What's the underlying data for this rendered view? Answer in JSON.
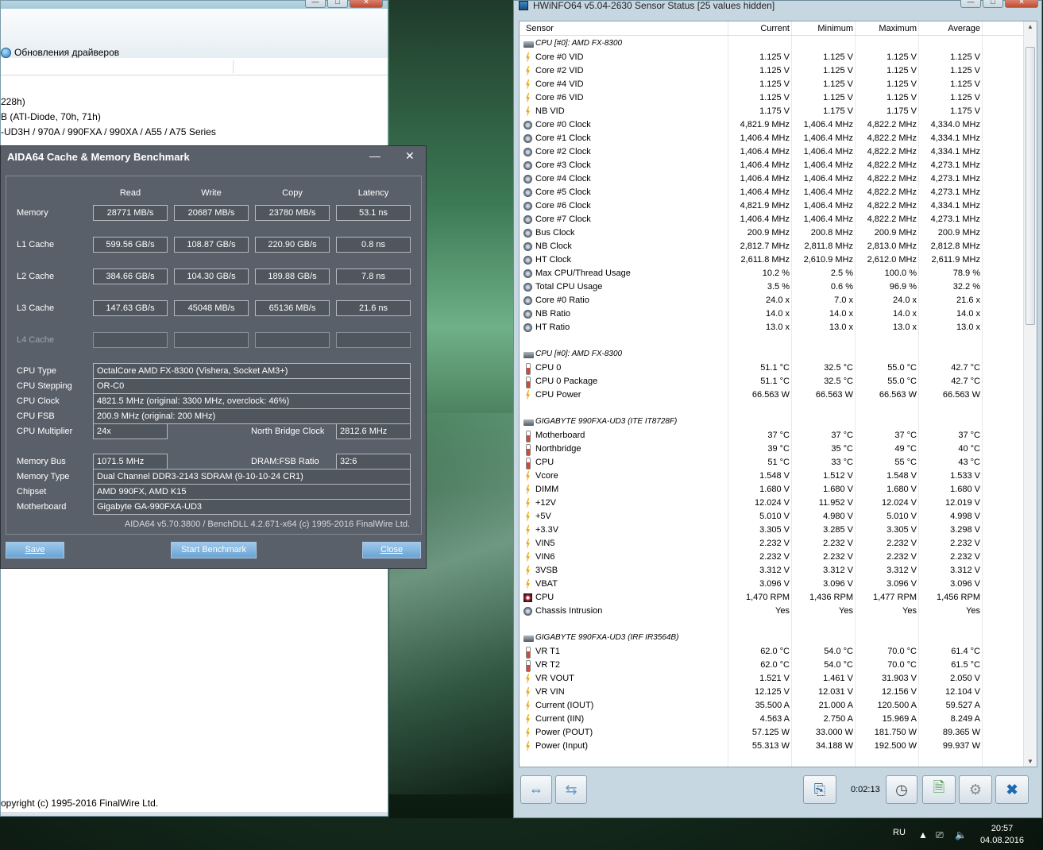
{
  "main_window": {
    "toolbar_item": "Обновления драйверов",
    "info_lines": [
      "228h)",
      "B  (ATI-Diode, 70h, 71h)",
      "-UD3H / 970A / 990FXA / 990XA / A55 / A75 Series"
    ],
    "footer": "opyright (c) 1995-2016 FinalWire Ltd."
  },
  "benchmark": {
    "title": "AIDA64 Cache & Memory Benchmark",
    "minimize": "—",
    "close": "✕",
    "columns": [
      "Read",
      "Write",
      "Copy",
      "Latency"
    ],
    "rows": [
      {
        "label": "Memory",
        "values": [
          "28771 MB/s",
          "20687 MB/s",
          "23780 MB/s",
          "53.1 ns"
        ]
      },
      {
        "label": "L1 Cache",
        "values": [
          "599.56 GB/s",
          "108.87 GB/s",
          "220.90 GB/s",
          "0.8 ns"
        ]
      },
      {
        "label": "L2 Cache",
        "values": [
          "384.66 GB/s",
          "104.30 GB/s",
          "189.88 GB/s",
          "7.8 ns"
        ]
      },
      {
        "label": "L3 Cache",
        "values": [
          "147.63 GB/s",
          "45048 MB/s",
          "65136 MB/s",
          "21.6 ns"
        ]
      },
      {
        "label": "L4 Cache",
        "values": [
          "",
          "",
          "",
          ""
        ]
      }
    ],
    "cpu_type_label": "CPU Type",
    "cpu_type": "OctalCore AMD FX-8300  (Vishera, Socket AM3+)",
    "cpu_stepping_label": "CPU Stepping",
    "cpu_stepping": "OR-C0",
    "cpu_clock_label": "CPU Clock",
    "cpu_clock": "4821.5 MHz  (original: 3300 MHz, overclock: 46%)",
    "cpu_fsb_label": "CPU FSB",
    "cpu_fsb": "200.9 MHz  (original: 200 MHz)",
    "cpu_mult_label": "CPU Multiplier",
    "cpu_mult": "24x",
    "nb_clock_label": "North Bridge Clock",
    "nb_clock": "2812.6 MHz",
    "mem_bus_label": "Memory Bus",
    "mem_bus": "1071.5 MHz",
    "dram_ratio_label": "DRAM:FSB Ratio",
    "dram_ratio": "32:6",
    "mem_type_label": "Memory Type",
    "mem_type": "Dual Channel DDR3-2143 SDRAM  (9-10-10-24 CR1)",
    "chipset_label": "Chipset",
    "chipset": "AMD 990FX, AMD K15",
    "mobo_label": "Motherboard",
    "mobo": "Gigabyte GA-990FXA-UD3",
    "version": "AIDA64 v5.70.3800 / BenchDLL 4.2.671-x64  (c) 1995-2016 FinalWire Ltd.",
    "save": "Save",
    "start": "Start Benchmark",
    "close_btn": "Close"
  },
  "hwinfo": {
    "title": "HWiNFO64 v5.04-2630 Sensor Status [25 values hidden]",
    "columns": [
      "Sensor",
      "Current",
      "Minimum",
      "Maximum",
      "Average"
    ],
    "timer": "0:02:13",
    "rows": [
      {
        "t": "grp",
        "n": "CPU [#0]: AMD FX-8300"
      },
      {
        "t": "volt",
        "n": "Core #0 VID",
        "v": [
          "1.125 V",
          "1.125 V",
          "1.125 V",
          "1.125 V"
        ]
      },
      {
        "t": "volt",
        "n": "Core #2 VID",
        "v": [
          "1.125 V",
          "1.125 V",
          "1.125 V",
          "1.125 V"
        ]
      },
      {
        "t": "volt",
        "n": "Core #4 VID",
        "v": [
          "1.125 V",
          "1.125 V",
          "1.125 V",
          "1.125 V"
        ]
      },
      {
        "t": "volt",
        "n": "Core #6 VID",
        "v": [
          "1.125 V",
          "1.125 V",
          "1.125 V",
          "1.125 V"
        ]
      },
      {
        "t": "volt",
        "n": "NB VID",
        "v": [
          "1.175 V",
          "1.175 V",
          "1.175 V",
          "1.175 V"
        ]
      },
      {
        "t": "clock",
        "n": "Core #0 Clock",
        "v": [
          "4,821.9 MHz",
          "1,406.4 MHz",
          "4,822.2 MHz",
          "4,334.0 MHz"
        ]
      },
      {
        "t": "clock",
        "n": "Core #1 Clock",
        "v": [
          "1,406.4 MHz",
          "1,406.4 MHz",
          "4,822.2 MHz",
          "4,334.1 MHz"
        ]
      },
      {
        "t": "clock",
        "n": "Core #2 Clock",
        "v": [
          "1,406.4 MHz",
          "1,406.4 MHz",
          "4,822.2 MHz",
          "4,334.1 MHz"
        ]
      },
      {
        "t": "clock",
        "n": "Core #3 Clock",
        "v": [
          "1,406.4 MHz",
          "1,406.4 MHz",
          "4,822.2 MHz",
          "4,273.1 MHz"
        ]
      },
      {
        "t": "clock",
        "n": "Core #4 Clock",
        "v": [
          "1,406.4 MHz",
          "1,406.4 MHz",
          "4,822.2 MHz",
          "4,273.1 MHz"
        ]
      },
      {
        "t": "clock",
        "n": "Core #5 Clock",
        "v": [
          "1,406.4 MHz",
          "1,406.4 MHz",
          "4,822.2 MHz",
          "4,273.1 MHz"
        ]
      },
      {
        "t": "clock",
        "n": "Core #6 Clock",
        "v": [
          "4,821.9 MHz",
          "1,406.4 MHz",
          "4,822.2 MHz",
          "4,334.1 MHz"
        ]
      },
      {
        "t": "clock",
        "n": "Core #7 Clock",
        "v": [
          "1,406.4 MHz",
          "1,406.4 MHz",
          "4,822.2 MHz",
          "4,273.1 MHz"
        ]
      },
      {
        "t": "clock",
        "n": "Bus Clock",
        "v": [
          "200.9 MHz",
          "200.8 MHz",
          "200.9 MHz",
          "200.9 MHz"
        ]
      },
      {
        "t": "clock",
        "n": "NB Clock",
        "v": [
          "2,812.7 MHz",
          "2,811.8 MHz",
          "2,813.0 MHz",
          "2,812.8 MHz"
        ]
      },
      {
        "t": "clock",
        "n": "HT Clock",
        "v": [
          "2,611.8 MHz",
          "2,610.9 MHz",
          "2,612.0 MHz",
          "2,611.9 MHz"
        ]
      },
      {
        "t": "clock",
        "n": "Max CPU/Thread Usage",
        "v": [
          "10.2 %",
          "2.5 %",
          "100.0 %",
          "78.9 %"
        ]
      },
      {
        "t": "clock",
        "n": "Total CPU Usage",
        "v": [
          "3.5 %",
          "0.6 %",
          "96.9 %",
          "32.2 %"
        ]
      },
      {
        "t": "clock",
        "n": "Core #0 Ratio",
        "v": [
          "24.0 x",
          "7.0 x",
          "24.0 x",
          "21.6 x"
        ]
      },
      {
        "t": "clock",
        "n": "NB Ratio",
        "v": [
          "14.0 x",
          "14.0 x",
          "14.0 x",
          "14.0 x"
        ]
      },
      {
        "t": "clock",
        "n": "HT Ratio",
        "v": [
          "13.0 x",
          "13.0 x",
          "13.0 x",
          "13.0 x"
        ]
      },
      {
        "t": "blank",
        "n": ""
      },
      {
        "t": "grp",
        "n": "CPU [#0]: AMD FX-8300"
      },
      {
        "t": "temp",
        "n": "CPU 0",
        "v": [
          "51.1 °C",
          "32.5 °C",
          "55.0 °C",
          "42.7 °C"
        ]
      },
      {
        "t": "temp",
        "n": "CPU 0 Package",
        "v": [
          "51.1 °C",
          "32.5 °C",
          "55.0 °C",
          "42.7 °C"
        ]
      },
      {
        "t": "volt",
        "n": "CPU Power",
        "v": [
          "66.563 W",
          "66.563 W",
          "66.563 W",
          "66.563 W"
        ]
      },
      {
        "t": "blank",
        "n": ""
      },
      {
        "t": "grp",
        "n": "GIGABYTE 990FXA-UD3 (ITE IT8728F)"
      },
      {
        "t": "temp",
        "n": "Motherboard",
        "v": [
          "37 °C",
          "37 °C",
          "37 °C",
          "37 °C"
        ]
      },
      {
        "t": "temp",
        "n": "Northbridge",
        "v": [
          "39 °C",
          "35 °C",
          "49 °C",
          "40 °C"
        ]
      },
      {
        "t": "temp",
        "n": "CPU",
        "v": [
          "51 °C",
          "33 °C",
          "55 °C",
          "43 °C"
        ]
      },
      {
        "t": "volt",
        "n": "Vcore",
        "v": [
          "1.548 V",
          "1.512 V",
          "1.548 V",
          "1.533 V"
        ]
      },
      {
        "t": "volt",
        "n": "DIMM",
        "v": [
          "1.680 V",
          "1.680 V",
          "1.680 V",
          "1.680 V"
        ]
      },
      {
        "t": "volt",
        "n": "+12V",
        "v": [
          "12.024 V",
          "11.952 V",
          "12.024 V",
          "12.019 V"
        ]
      },
      {
        "t": "volt",
        "n": "+5V",
        "v": [
          "5.010 V",
          "4.980 V",
          "5.010 V",
          "4.998 V"
        ]
      },
      {
        "t": "volt",
        "n": "+3.3V",
        "v": [
          "3.305 V",
          "3.285 V",
          "3.305 V",
          "3.298 V"
        ]
      },
      {
        "t": "volt",
        "n": "VIN5",
        "v": [
          "2.232 V",
          "2.232 V",
          "2.232 V",
          "2.232 V"
        ]
      },
      {
        "t": "volt",
        "n": "VIN6",
        "v": [
          "2.232 V",
          "2.232 V",
          "2.232 V",
          "2.232 V"
        ]
      },
      {
        "t": "volt",
        "n": "3VSB",
        "v": [
          "3.312 V",
          "3.312 V",
          "3.312 V",
          "3.312 V"
        ]
      },
      {
        "t": "volt",
        "n": "VBAT",
        "v": [
          "3.096 V",
          "3.096 V",
          "3.096 V",
          "3.096 V"
        ]
      },
      {
        "t": "fan",
        "n": "CPU",
        "v": [
          "1,470 RPM",
          "1,436 RPM",
          "1,477 RPM",
          "1,456 RPM"
        ]
      },
      {
        "t": "clock",
        "n": "Chassis Intrusion",
        "v": [
          "Yes",
          "Yes",
          "Yes",
          "Yes"
        ]
      },
      {
        "t": "blank",
        "n": ""
      },
      {
        "t": "grp",
        "n": "GIGABYTE 990FXA-UD3 (IRF IR3564B)"
      },
      {
        "t": "temp",
        "n": "VR T1",
        "v": [
          "62.0 °C",
          "54.0 °C",
          "70.0 °C",
          "61.4 °C"
        ]
      },
      {
        "t": "temp",
        "n": "VR T2",
        "v": [
          "62.0 °C",
          "54.0 °C",
          "70.0 °C",
          "61.5 °C"
        ]
      },
      {
        "t": "volt",
        "n": "VR VOUT",
        "v": [
          "1.521 V",
          "1.461 V",
          "31.903 V",
          "2.050 V"
        ]
      },
      {
        "t": "volt",
        "n": "VR VIN",
        "v": [
          "12.125 V",
          "12.031 V",
          "12.156 V",
          "12.104 V"
        ]
      },
      {
        "t": "volt",
        "n": "Current (IOUT)",
        "v": [
          "35.500 A",
          "21.000 A",
          "120.500 A",
          "59.527 A"
        ]
      },
      {
        "t": "volt",
        "n": "Current (IIN)",
        "v": [
          "4.563 A",
          "2.750 A",
          "15.969 A",
          "8.249 A"
        ]
      },
      {
        "t": "volt",
        "n": "Power (POUT)",
        "v": [
          "57.125 W",
          "33.000 W",
          "181.750 W",
          "89.365 W"
        ]
      },
      {
        "t": "volt",
        "n": "Power (Input)",
        "v": [
          "55.313 W",
          "34.188 W",
          "192.500 W",
          "99.937 W"
        ]
      }
    ]
  },
  "tray": {
    "lang": "RU",
    "time": "20:57",
    "date": "04.08.2016"
  },
  "colors": {
    "dialog_bg": "#5a606a",
    "button_blue": "#7ab0dc",
    "hwinfo_frame": "#c7d7e2"
  }
}
